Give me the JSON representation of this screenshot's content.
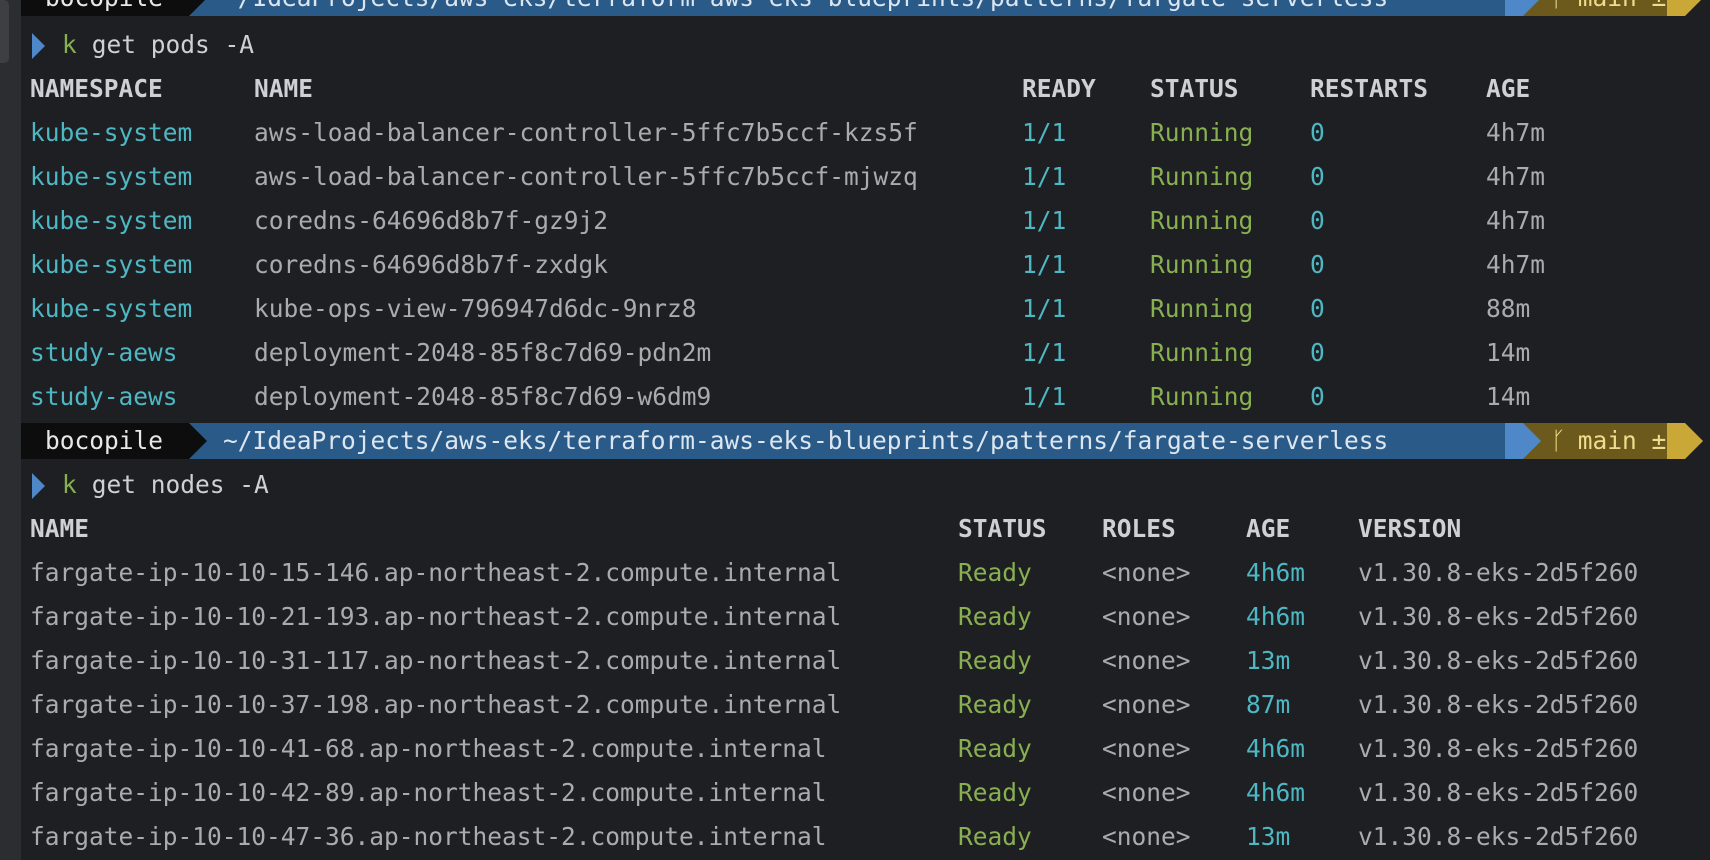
{
  "prompt": {
    "user": "bocopile",
    "path": "~/IdeaProjects/aws-eks/terraform-aws-eks-blueprints/patterns/fargate-serverless",
    "branch": "main ±",
    "branch_icon": "git-branch-icon"
  },
  "pods_command": {
    "k": "k",
    "rest": " get pods -A"
  },
  "pods_headers": [
    "NAMESPACE",
    "NAME",
    "READY",
    "STATUS",
    "RESTARTS",
    "AGE"
  ],
  "pods_rows": [
    [
      "kube-system",
      "aws-load-balancer-controller-5ffc7b5ccf-kzs5f",
      "1/1",
      "Running",
      "0",
      "4h7m"
    ],
    [
      "kube-system",
      "aws-load-balancer-controller-5ffc7b5ccf-mjwzq",
      "1/1",
      "Running",
      "0",
      "4h7m"
    ],
    [
      "kube-system",
      "coredns-64696d8b7f-gz9j2",
      "1/1",
      "Running",
      "0",
      "4h7m"
    ],
    [
      "kube-system",
      "coredns-64696d8b7f-zxdgk",
      "1/1",
      "Running",
      "0",
      "4h7m"
    ],
    [
      "kube-system",
      "kube-ops-view-796947d6dc-9nrz8",
      "1/1",
      "Running",
      "0",
      "88m"
    ],
    [
      "study-aews",
      "deployment-2048-85f8c7d69-pdn2m",
      "1/1",
      "Running",
      "0",
      "14m"
    ],
    [
      "study-aews",
      "deployment-2048-85f8c7d69-w6dm9",
      "1/1",
      "Running",
      "0",
      "14m"
    ]
  ],
  "nodes_command": {
    "k": "k",
    "rest": " get nodes -A"
  },
  "nodes_headers": [
    "NAME",
    "STATUS",
    "ROLES",
    "AGE",
    "VERSION"
  ],
  "nodes_rows": [
    [
      "fargate-ip-10-10-15-146.ap-northeast-2.compute.internal",
      "Ready",
      "<none>",
      "4h6m",
      "v1.30.8-eks-2d5f260"
    ],
    [
      "fargate-ip-10-10-21-193.ap-northeast-2.compute.internal",
      "Ready",
      "<none>",
      "4h6m",
      "v1.30.8-eks-2d5f260"
    ],
    [
      "fargate-ip-10-10-31-117.ap-northeast-2.compute.internal",
      "Ready",
      "<none>",
      "13m",
      "v1.30.8-eks-2d5f260"
    ],
    [
      "fargate-ip-10-10-37-198.ap-northeast-2.compute.internal",
      "Ready",
      "<none>",
      "87m",
      "v1.30.8-eks-2d5f260"
    ],
    [
      "fargate-ip-10-10-41-68.ap-northeast-2.compute.internal",
      "Ready",
      "<none>",
      "4h6m",
      "v1.30.8-eks-2d5f260"
    ],
    [
      "fargate-ip-10-10-42-89.ap-northeast-2.compute.internal",
      "Ready",
      "<none>",
      "4h6m",
      "v1.30.8-eks-2d5f260"
    ],
    [
      "fargate-ip-10-10-47-36.ap-northeast-2.compute.internal",
      "Ready",
      "<none>",
      "13m",
      "v1.30.8-eks-2d5f260"
    ]
  ],
  "colors": {
    "background": "#1e1f22",
    "cyan": "#4eb7c4",
    "green": "#88b050",
    "path_segment": "#2a5a88",
    "git_segment": "#6b5a1c"
  }
}
